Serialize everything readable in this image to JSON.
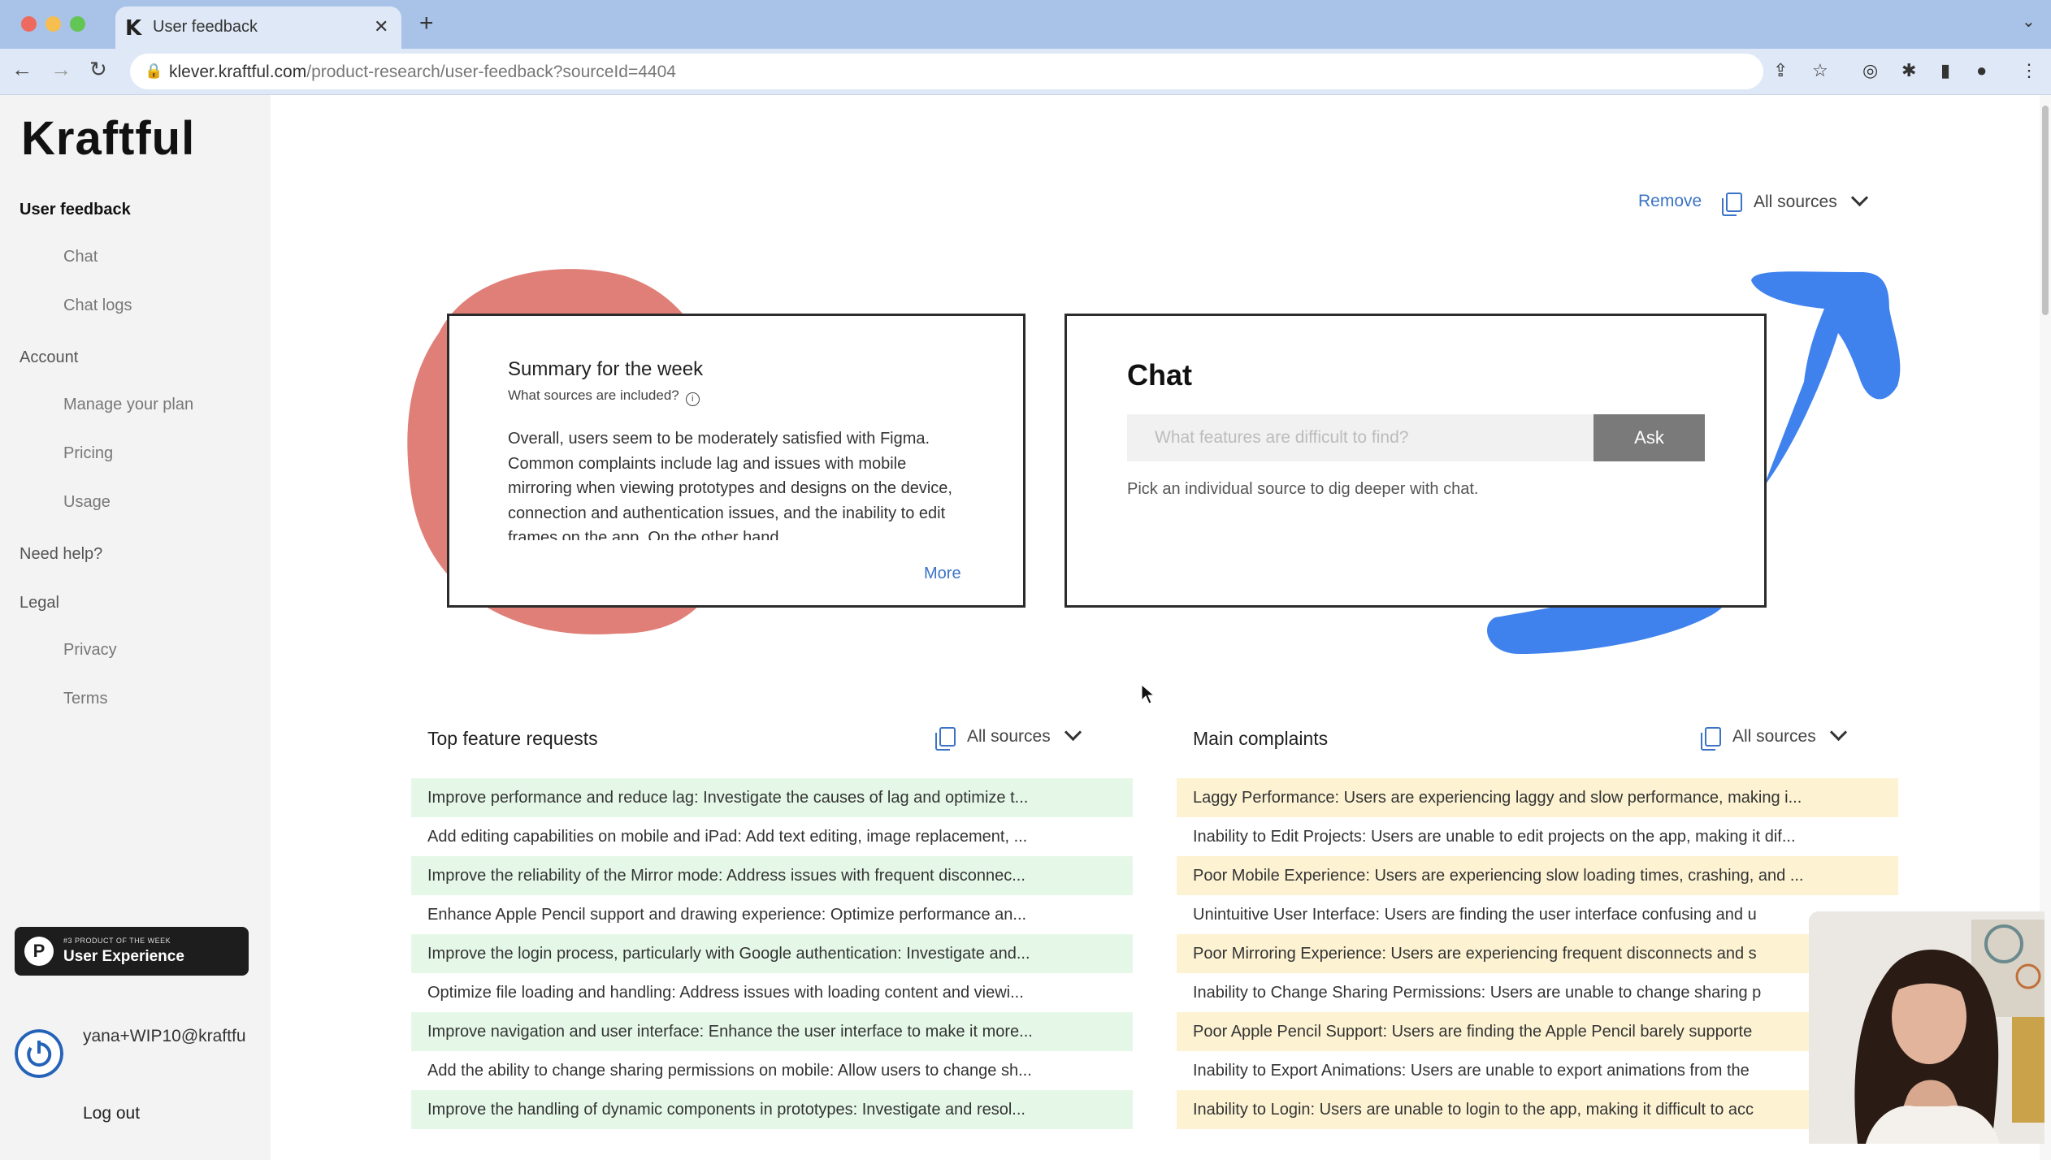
{
  "browser": {
    "tab_title": "User feedback",
    "url_host": "klever.kraftful.com",
    "url_path": "/product-research/user-feedback?sourceId=4404"
  },
  "sidebar": {
    "logo": "Kraftful",
    "sections": {
      "user_feedback": "User feedback",
      "chat": "Chat",
      "chat_logs": "Chat logs",
      "account": "Account",
      "manage_plan": "Manage your plan",
      "pricing": "Pricing",
      "usage": "Usage",
      "need_help": "Need help?",
      "legal": "Legal",
      "privacy": "Privacy",
      "terms": "Terms"
    },
    "badge": {
      "letter": "P",
      "small": "#3 PRODUCT OF THE WEEK",
      "big": "User Experience"
    },
    "user_email": "yana+WIP10@kraftfu",
    "logout": "Log out"
  },
  "header": {
    "remove": "Remove",
    "sources": "All sources"
  },
  "summary": {
    "title": "Summary for the week",
    "subtitle": "What sources are included?",
    "body": "Overall, users seem to be moderately satisfied with Figma. Common complaints include lag and issues with mobile mirroring when viewing prototypes and designs on the device, connection and authentication issues, and the inability to edit frames on the app. On the other hand,",
    "more": "More"
  },
  "chat": {
    "title": "Chat",
    "placeholder": "What features are difficult to find?",
    "ask": "Ask",
    "hint": "Pick an individual source to dig deeper with chat."
  },
  "feature_requests": {
    "title": "Top feature requests",
    "sources": "All sources",
    "items": [
      "Improve performance and reduce lag: Investigate the causes of lag and optimize t...",
      "Add editing capabilities on mobile and iPad: Add text editing, image replacement, ...",
      "Improve the reliability of the Mirror mode: Address issues with frequent disconnec...",
      "Enhance Apple Pencil support and drawing experience: Optimize performance an...",
      "Improve the login process, particularly with Google authentication: Investigate and...",
      "Optimize file loading and handling: Address issues with loading content and viewi...",
      "Improve navigation and user interface: Enhance the user interface to make it more...",
      "Add the ability to change sharing permissions on mobile: Allow users to change sh...",
      "Improve the handling of dynamic components in prototypes: Investigate and resol..."
    ]
  },
  "complaints": {
    "title": "Main complaints",
    "sources": "All sources",
    "items": [
      "Laggy Performance: Users are experiencing laggy and slow performance, making i...",
      "Inability to Edit Projects: Users are unable to edit projects on the app, making it dif...",
      "Poor Mobile Experience: Users are experiencing slow loading times, crashing, and ...",
      "Unintuitive User Interface: Users are finding the user interface confusing and u",
      "Poor Mirroring Experience: Users are experiencing frequent disconnects and s",
      "Inability to Change Sharing Permissions: Users are unable to change sharing p",
      "Poor Apple Pencil Support: Users are finding the Apple Pencil barely supporte",
      "Inability to Export Animations: Users are unable to export animations from the",
      "Inability to Login: Users are unable to login to the app, making it difficult to acc"
    ]
  },
  "colors": {
    "accent_blue": "#3b73c6",
    "blob_red": "#e07f78",
    "arrow_blue": "#3f82ee",
    "row_green": "#e5f8e8",
    "row_yellow": "#fdf3d3"
  }
}
